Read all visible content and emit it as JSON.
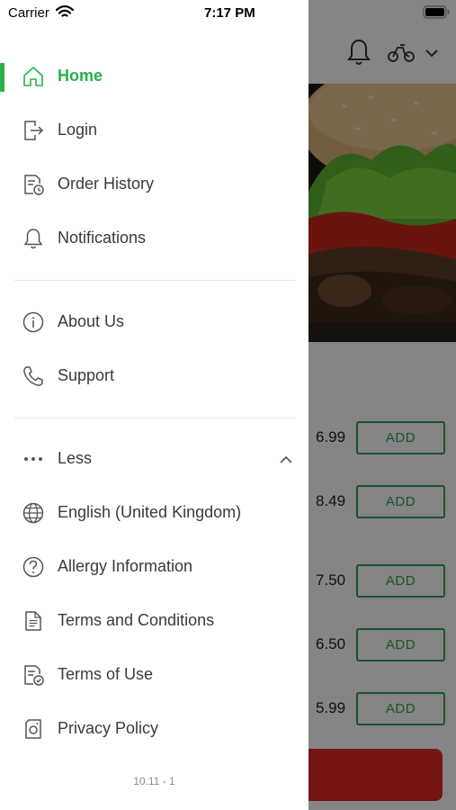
{
  "status_bar": {
    "carrier": "Carrier",
    "time": "7:17 PM"
  },
  "drawer": {
    "sections": [
      [
        {
          "label": "Home",
          "icon": "home-icon",
          "active": true
        },
        {
          "label": "Login",
          "icon": "login-icon"
        },
        {
          "label": "Order History",
          "icon": "order-history-icon"
        },
        {
          "label": "Notifications",
          "icon": "bell-icon"
        }
      ],
      [
        {
          "label": "About Us",
          "icon": "info-icon"
        },
        {
          "label": "Support",
          "icon": "phone-icon"
        }
      ],
      [
        {
          "label": "Less",
          "icon": "more-dots-icon",
          "expanded": true
        },
        {
          "label": "English (United Kingdom)",
          "icon": "globe-icon"
        },
        {
          "label": "Allergy Information",
          "icon": "question-icon"
        },
        {
          "label": "Terms and Conditions",
          "icon": "document-icon"
        },
        {
          "label": "Terms of Use",
          "icon": "document-check-icon"
        },
        {
          "label": "Privacy Policy",
          "icon": "privacy-icon"
        }
      ]
    ],
    "version": "10.11 - 1"
  },
  "background": {
    "menu_prices": [
      "6.99",
      "8.49",
      "7.50",
      "6.50",
      "5.99"
    ],
    "add_label": "ADD"
  },
  "colors": {
    "accent": "#27b14c",
    "add_green": "#2ea44f",
    "cta_red": "#e12a27"
  }
}
